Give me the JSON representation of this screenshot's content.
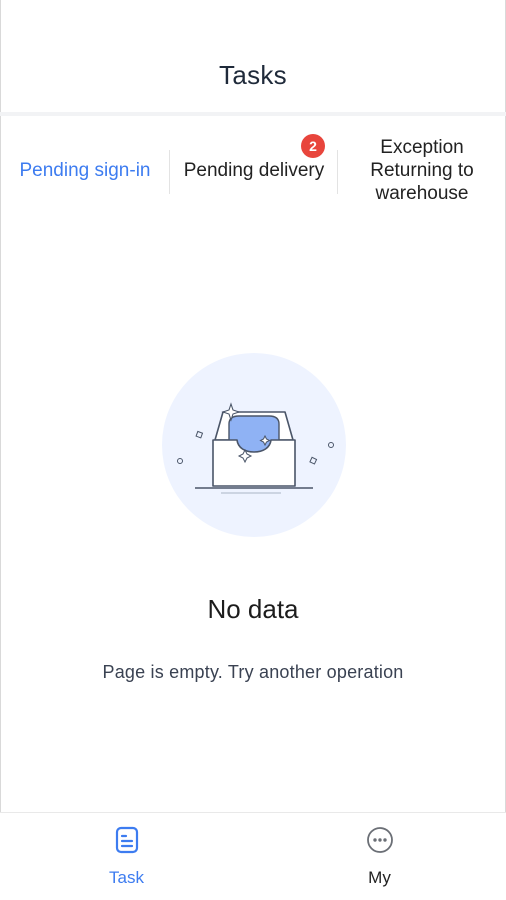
{
  "header": {
    "title": "Tasks"
  },
  "tabs": [
    {
      "label": "Pending sign-in",
      "active": true
    },
    {
      "label": "Pending delivery",
      "badge": "2"
    },
    {
      "label": "Exception Returning to warehouse"
    }
  ],
  "empty_state": {
    "title": "No data",
    "subtitle": "Page is empty. Try another operation",
    "illustration": "empty-inbox-icon"
  },
  "bottom_nav": {
    "items": [
      {
        "label": "Task",
        "icon": "task-list-icon",
        "active": true
      },
      {
        "label": "My",
        "icon": "more-circle-icon"
      }
    ]
  },
  "colors": {
    "accent": "#3d7cf0",
    "badge": "#e8453c",
    "illustration_bg": "#eef3ff"
  }
}
